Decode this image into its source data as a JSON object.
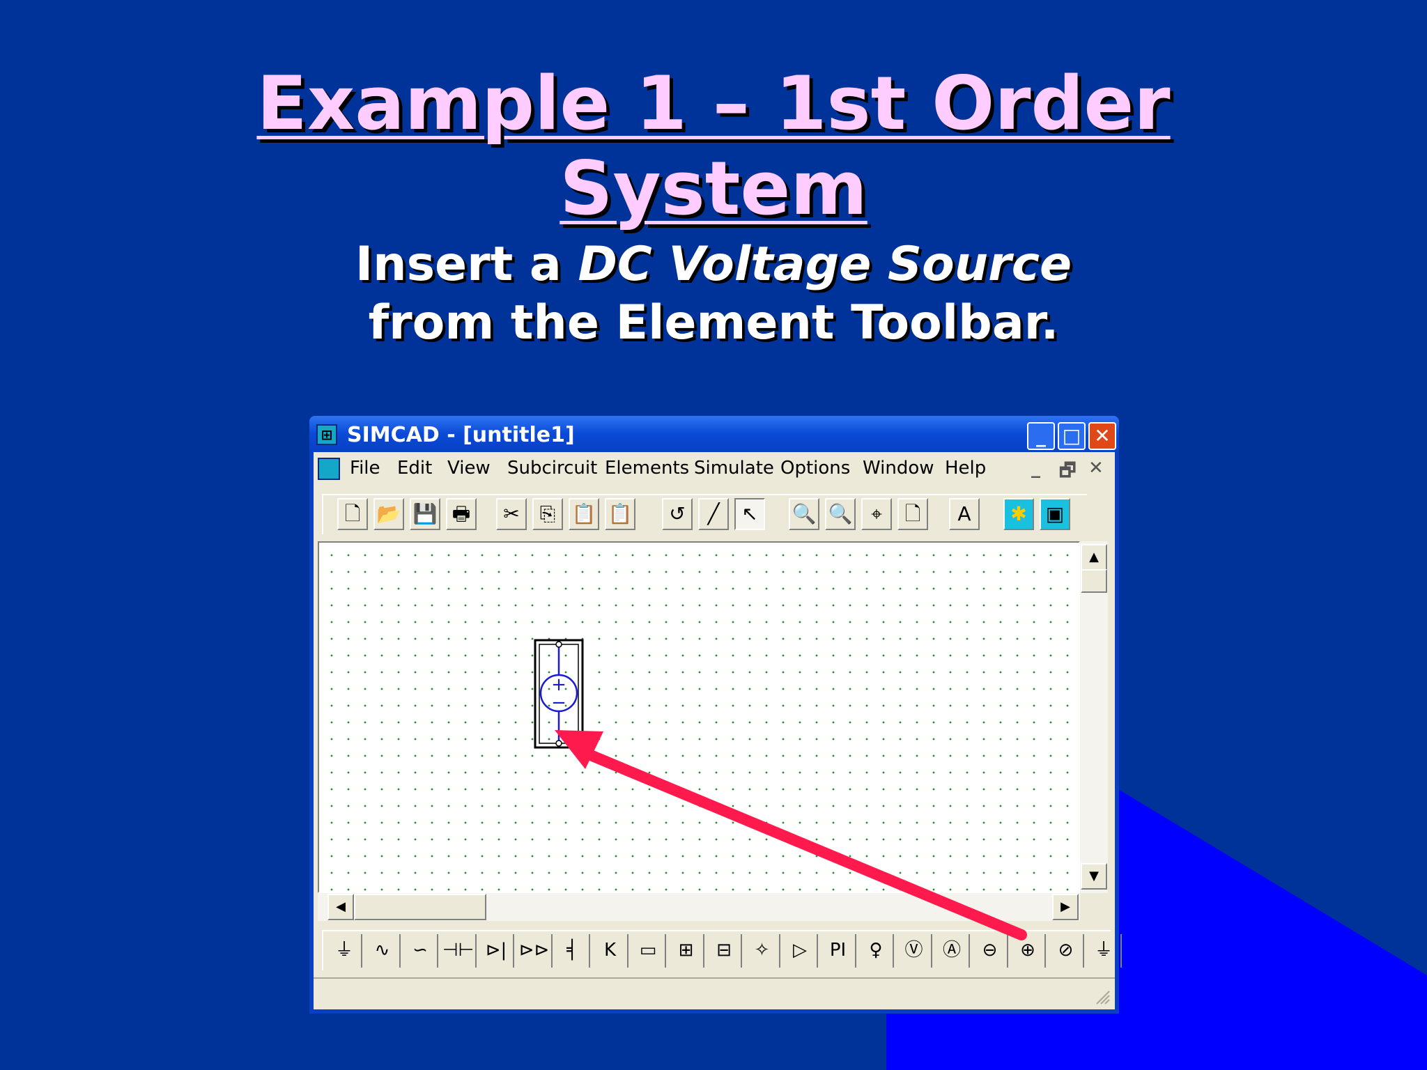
{
  "slide": {
    "title_line1": "Example 1 – 1st Order",
    "title_line2": "System",
    "subtitle_prefix": "Insert a ",
    "subtitle_emphasis": "DC Voltage Source",
    "subtitle_line2": "from the Element Toolbar."
  },
  "window": {
    "title": "SIMCAD - [untitle1]",
    "caption_minimize": "_",
    "caption_maximize": "□",
    "caption_close": "✕",
    "app_icon": "simcad-app-icon"
  },
  "menubar": {
    "items": [
      "File",
      "Edit",
      "View",
      "Subcircuit",
      "Elements",
      "Simulate",
      "Options",
      "Window",
      "Help"
    ],
    "mdi_minimize": "_",
    "mdi_restore": "🗗",
    "mdi_close": "✕"
  },
  "toolbar": {
    "icons": [
      "new-file-icon",
      "open-folder-icon",
      "save-icon",
      "print-icon",
      "cut-icon",
      "copy-icon",
      "paste-icon",
      "clipboard-icon",
      "rotate-icon",
      "draw-wire-icon",
      "pointer-icon",
      "zoom-in-icon",
      "zoom-out-icon",
      "zoom-fit-icon",
      "page-icon",
      "text-icon",
      "simulate-icon",
      "scope-icon"
    ],
    "glyphs": [
      "🗋",
      "📂",
      "💾",
      "🖶",
      "✂",
      "⎘",
      "📋",
      "📋",
      "↺",
      "╱",
      "↖",
      "🔍",
      "🔍",
      "⌖",
      "🗋",
      "A",
      "✱",
      "▣"
    ]
  },
  "element_toolbar": {
    "icons": [
      "ground-icon",
      "resistor-icon",
      "inductor-icon",
      "capacitor-icon",
      "diode-icon",
      "zener-diode-icon",
      "mosfet-icon",
      "igbt-icon",
      "transformer-icon",
      "switch-module-icon",
      "switch-module-2-icon",
      "lamp-icon",
      "opamp-icon",
      "pi-controller-icon",
      "voltage-probe-icon",
      "voltmeter-icon",
      "ammeter-icon",
      "ac-source-icon",
      "dc-voltage-source-icon",
      "current-source-icon",
      "more-icon"
    ],
    "glyphs": [
      "⏚",
      "∿",
      "∽",
      "⊣⊢",
      "⊳|",
      "⊳⊳",
      "╡",
      "K",
      "▭",
      "⊞",
      "⊟",
      "✧",
      "▷",
      "PI",
      "♀",
      "Ⓥ",
      "Ⓐ",
      "⊖",
      "⊕",
      "⊘",
      "⏚"
    ]
  },
  "canvas": {
    "component": "DC Voltage Source",
    "plus_sign": "+",
    "minus_sign": "−"
  },
  "scroll": {
    "up": "▲",
    "down": "▼",
    "left": "◀",
    "right": "▶"
  },
  "colors": {
    "background": "#003399",
    "title": "#ffccff",
    "arrow": "#ff1a4d",
    "accent_triangle": "#0000ff"
  }
}
